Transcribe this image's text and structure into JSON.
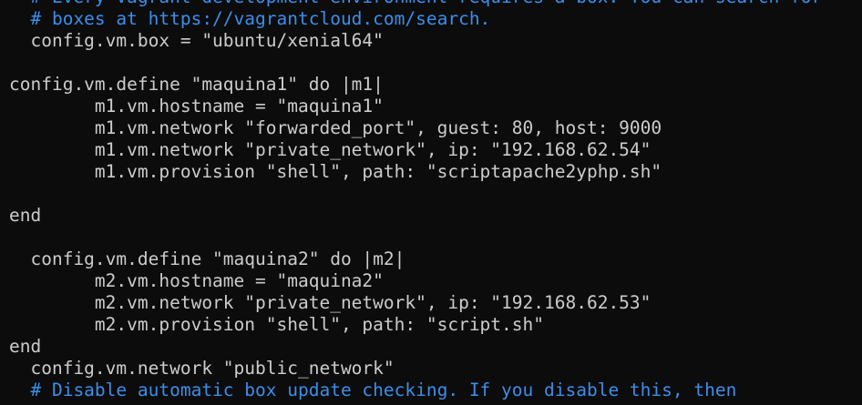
{
  "terminal": {
    "lines": [
      {
        "text": "  # Every Vagrant development environment requires a box. You can search for",
        "kind": "comment"
      },
      {
        "text": "  # boxes at https://vagrantcloud.com/search.",
        "kind": "comment"
      },
      {
        "text": "  config.vm.box = \"ubuntu/xenial64\"",
        "kind": "code"
      },
      {
        "text": "",
        "kind": "code"
      },
      {
        "text": "config.vm.define \"maquina1\" do |m1|",
        "kind": "code"
      },
      {
        "text": "        m1.vm.hostname = \"maquina1\"",
        "kind": "code"
      },
      {
        "text": "        m1.vm.network \"forwarded_port\", guest: 80, host: 9000",
        "kind": "code"
      },
      {
        "text": "        m1.vm.network \"private_network\", ip: \"192.168.62.54\"",
        "kind": "code"
      },
      {
        "text": "        m1.vm.provision \"shell\", path: \"scriptapache2yphp.sh\"",
        "kind": "code"
      },
      {
        "text": "",
        "kind": "code"
      },
      {
        "text": "end",
        "kind": "code"
      },
      {
        "text": "",
        "kind": "code"
      },
      {
        "text": "  config.vm.define \"maquina2\" do |m2|",
        "kind": "code"
      },
      {
        "text": "        m2.vm.hostname = \"maquina2\"",
        "kind": "code"
      },
      {
        "text": "        m2.vm.network \"private_network\", ip: \"192.168.62.53\"",
        "kind": "code"
      },
      {
        "text": "        m2.vm.provision \"shell\", path: \"script.sh\"",
        "kind": "code"
      },
      {
        "text": "end",
        "kind": "code"
      },
      {
        "text": "  config.vm.network \"public_network\"",
        "kind": "code"
      },
      {
        "text": "  # Disable automatic box update checking. If you disable this, then",
        "kind": "comment"
      }
    ]
  },
  "colors": {
    "background": "#0c0c0c",
    "text": "#cccccc",
    "comment": "#3b8eea"
  }
}
